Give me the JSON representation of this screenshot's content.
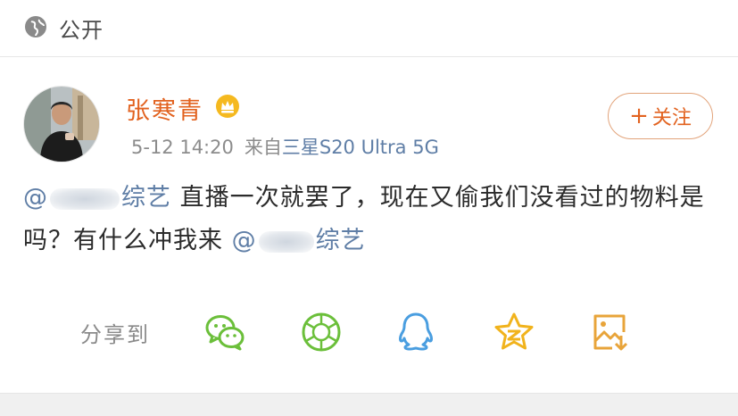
{
  "visibility": {
    "label": "公开",
    "icon": "globe-icon"
  },
  "post": {
    "author": {
      "name": "张寒青",
      "badge_icon": "crown-icon"
    },
    "time": "5-12 14:20",
    "source_prefix": "来自",
    "device": "三星S20 Ultra 5G",
    "follow_label": "关注",
    "content": {
      "mention1_prefix": "@",
      "mention1_suffix": "综艺",
      "text": " 直播一次就罢了，现在又偷我们没看过的物料是吗？有什么冲我来 ",
      "mention2_prefix": "@",
      "mention2_suffix": "综艺"
    }
  },
  "share": {
    "label": "分享到",
    "targets": [
      "wechat-icon",
      "moments-icon",
      "qq-icon",
      "qzone-icon",
      "save-image-icon"
    ]
  },
  "colors": {
    "accent": "#e2621f",
    "link": "#5f7ea6",
    "wechat_green": "#6bbf3a",
    "qq_blue": "#4a9ee0",
    "qzone_yellow": "#f1b31c",
    "save_orange": "#e8a43a"
  }
}
